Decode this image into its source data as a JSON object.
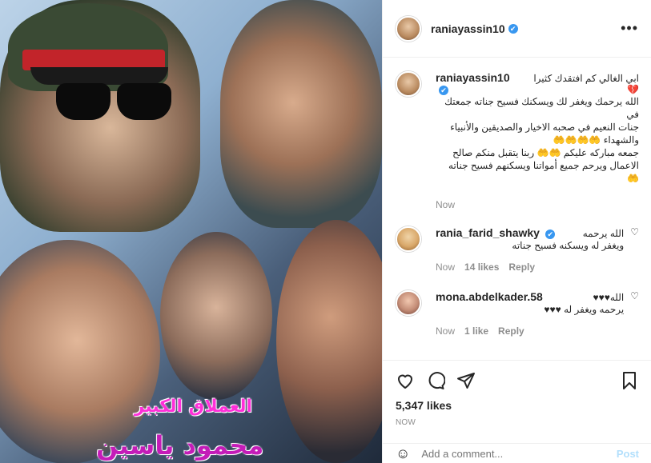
{
  "photo": {
    "title_line1": "العملاق الكبير",
    "title_line2": "محمود ياسين"
  },
  "post": {
    "username": "raniayassin10",
    "verified_mark": "✔",
    "more_label": "•••"
  },
  "caption": {
    "username": "raniayassin10",
    "first_line": "ابي الغالي كم افتقدك كثيرا 💔",
    "lines": [
      "الله يرحمك ويغفر لك ويسكنك فسيح جناته جمعتك في",
      "جنات النعيم في صحبه الاخيار والصديقين والأنبياء",
      "والشهداء 🤲🤲🤲🤲",
      "جمعه مباركه عليكم 🤲🤲 ربنا يتقبل منكم صالح",
      "الاعمال ويرحم جميع أمواتنا ويسكنهم فسيح جناته",
      "🤲"
    ],
    "time": "Now"
  },
  "comments": [
    {
      "username": "rania_farid_shawky",
      "verified": true,
      "lines": [
        "الله يرحمه",
        "ويغفر له ويسكنه فسيح جناته"
      ],
      "time": "Now",
      "likes": "14 likes",
      "reply": "Reply"
    },
    {
      "username": "mona.abdelkader.58",
      "verified": false,
      "lines": [
        "الله♥♥♥",
        "يرحمه ويغفر له ♥♥♥"
      ],
      "time": "Now",
      "likes": "1 like",
      "reply": "Reply"
    }
  ],
  "actions": {
    "likes": "5,347 likes",
    "date": "NOW"
  },
  "add_comment": {
    "placeholder": "Add a comment...",
    "post_label": "Post"
  },
  "icons": [
    "heart-icon",
    "comment-icon",
    "share-icon",
    "bookmark-icon",
    "more-icon",
    "emoji-icon"
  ]
}
